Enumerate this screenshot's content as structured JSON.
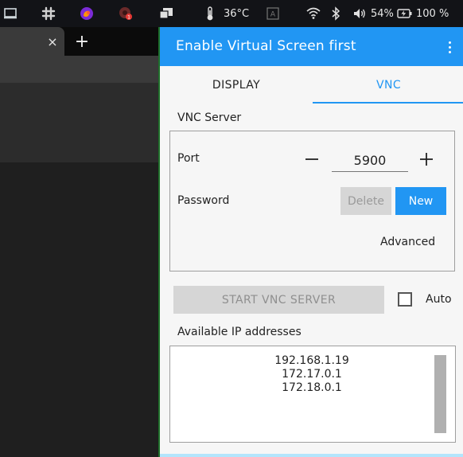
{
  "topbar": {
    "temperature": "36°C",
    "battery_percent": "54%",
    "battery_charge": "100 %",
    "icons": [
      "screen-icon",
      "slack-icon",
      "firefox-icon",
      "notification-app-icon",
      "screens-icon",
      "thermometer-icon",
      "keyboard-icon",
      "wifi-icon",
      "bluetooth-icon",
      "volume-icon",
      "battery-charging-icon"
    ]
  },
  "browser": {
    "close_tab": "×",
    "new_tab": "+"
  },
  "app": {
    "title": "Enable Virtual Screen first",
    "tabs": [
      {
        "label": "DISPLAY",
        "active": false
      },
      {
        "label": "VNC",
        "active": true
      }
    ],
    "vnc_server": {
      "section_label": "VNC Server",
      "port_label": "Port",
      "port_value": "5900",
      "password_label": "Password",
      "delete_label": "Delete",
      "new_label": "New",
      "advanced_label": "Advanced"
    },
    "start_button": "START VNC SERVER",
    "auto_label": "Auto",
    "auto_checked": false,
    "ip_section_label": "Available IP addresses",
    "ip_addresses": [
      "192.168.1.19",
      "172.17.0.1",
      "172.18.0.1"
    ]
  },
  "colors": {
    "accent": "#2196f3",
    "panel": "#121317"
  }
}
